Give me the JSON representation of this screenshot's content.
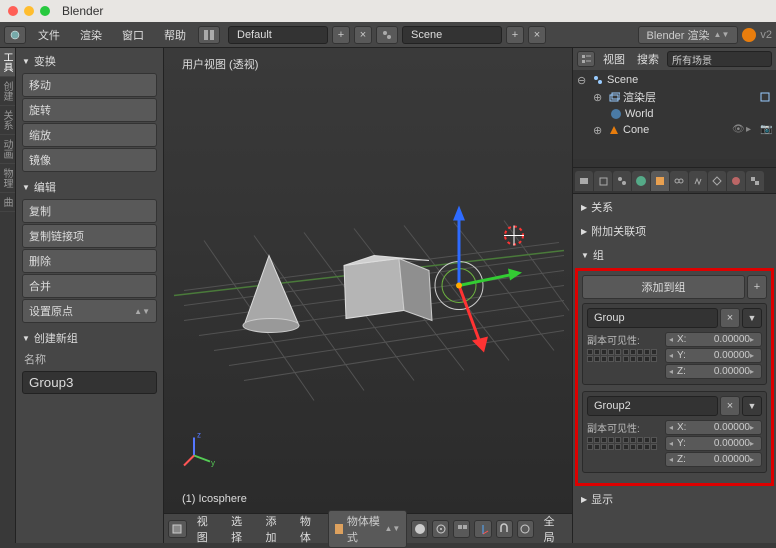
{
  "window": {
    "title": "Blender"
  },
  "menubar": {
    "file": "文件",
    "render": "渲染",
    "window": "窗口",
    "help": "帮助",
    "layout": "Default",
    "scene": "Scene",
    "engine": "Blender 渲染",
    "version": "v2"
  },
  "vtabs": [
    "工具",
    "创建",
    "关系",
    "动画",
    "物理",
    "曲"
  ],
  "left_panel": {
    "transform": {
      "header": "变换",
      "move": "移动",
      "rotate": "旋转",
      "scale": "缩放",
      "mirror": "镜像"
    },
    "edit": {
      "header": "编辑",
      "duplicate": "复制",
      "dup_linked": "复制链接项",
      "delete": "删除",
      "join": "合并",
      "set_origin": "设置原点"
    },
    "create_group": {
      "header": "创建新组",
      "name_label": "名称",
      "name_value": "Group3"
    }
  },
  "viewport": {
    "label": "用户视图 (透视)",
    "object_stats": "(1) Icosphere",
    "header": {
      "view": "视图",
      "select": "选择",
      "add": "添加",
      "object": "物体",
      "mode": "物体模式",
      "global": "全局"
    }
  },
  "outliner": {
    "hdr_view": "视图",
    "hdr_search": "搜索",
    "hdr_scene_filter": "所有场景",
    "tree": {
      "scene": "Scene",
      "render_layers": "渲染层",
      "world": "World",
      "cone": "Cone"
    }
  },
  "properties": {
    "relations": "关系",
    "relations_extras": "附加关联项",
    "group": "组",
    "add_to_group": "添加到组",
    "groups": [
      {
        "name": "Group",
        "dupli_label": "副本可见性:",
        "x_label": "X:",
        "x_val": "0.00000",
        "y_label": "Y:",
        "y_val": "0.00000",
        "z_label": "Z:",
        "z_val": "0.00000"
      },
      {
        "name": "Group2",
        "dupli_label": "副本可见性:",
        "x_label": "X:",
        "x_val": "0.00000",
        "y_label": "Y:",
        "y_val": "0.00000",
        "z_label": "Z:",
        "z_val": "0.00000"
      }
    ],
    "display": "显示"
  }
}
